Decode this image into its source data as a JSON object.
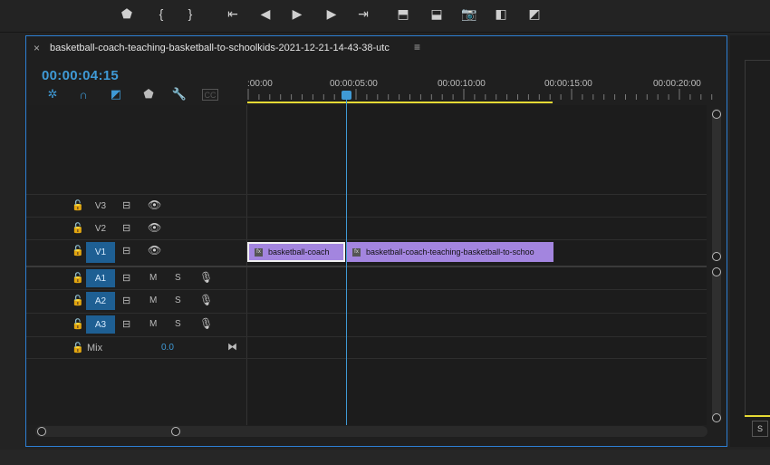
{
  "transport": {
    "buttons": [
      {
        "name": "add-marker-icon",
        "glyph": "⬟"
      },
      {
        "name": "mark-in-icon",
        "glyph": "{"
      },
      {
        "name": "mark-out-icon",
        "glyph": "}"
      },
      {
        "name": "go-to-in-icon",
        "glyph": "⇤"
      },
      {
        "name": "step-back-icon",
        "glyph": "◀"
      },
      {
        "name": "play-icon",
        "glyph": "▶"
      },
      {
        "name": "step-forward-icon",
        "glyph": "▶"
      },
      {
        "name": "go-to-out-icon",
        "glyph": "⇥"
      },
      {
        "name": "lift-icon",
        "glyph": "⬒"
      },
      {
        "name": "extract-icon",
        "glyph": "⬓"
      },
      {
        "name": "export-frame-icon",
        "glyph": "📷"
      },
      {
        "name": "compare-icon",
        "glyph": "◧"
      },
      {
        "name": "button-editor-icon",
        "glyph": "◩"
      }
    ]
  },
  "sequence": {
    "close_glyph": "×",
    "name": "basketball-coach-teaching-basketball-to-schoolkids-2021-12-21-14-43-38-utc",
    "menu_glyph": "≡",
    "timecode": "00:00:04:15"
  },
  "tools": [
    {
      "name": "snap-in-sequence-icon",
      "glyph": "✲"
    },
    {
      "name": "linked-selection-icon",
      "glyph": "∩"
    },
    {
      "name": "insert-overwrite-icon",
      "glyph": "◩"
    },
    {
      "name": "add-marker-tool-icon",
      "glyph": "⬟"
    },
    {
      "name": "settings-wrench-icon",
      "glyph": "🔧"
    },
    {
      "name": "captions-icon",
      "glyph": "CC"
    }
  ],
  "ruler": {
    "labels": [
      ":00:00",
      "00:00:05:00",
      "00:00:10:00",
      "00:00:15:00",
      "00:00:20:00"
    ]
  },
  "video_tracks": [
    {
      "name": "V3",
      "lock": "🔓",
      "sync": "⊟",
      "eye": "👁"
    },
    {
      "name": "V2",
      "lock": "🔓",
      "sync": "⊟",
      "eye": "👁"
    },
    {
      "name": "V1",
      "lock": "🔓",
      "sync": "⊟",
      "eye": "👁"
    }
  ],
  "audio_tracks": [
    {
      "name": "A1",
      "lock": "🔓",
      "sync": "⊟",
      "mute": "M",
      "solo": "S",
      "mic": "🎙"
    },
    {
      "name": "A2",
      "lock": "🔓",
      "sync": "⊟",
      "mute": "M",
      "solo": "S",
      "mic": "🎙"
    },
    {
      "name": "A3",
      "lock": "🔓",
      "sync": "⊟",
      "mute": "M",
      "solo": "S",
      "mic": "🎙"
    }
  ],
  "mix": {
    "lock": "🔓",
    "label": "Mix",
    "value": "0.0",
    "end_glyph": "⧓"
  },
  "clips": [
    {
      "label": "basketball-coach",
      "fx": "fx"
    },
    {
      "label": "basketball-coach-teaching-basketball-to-schoo",
      "fx": "fx"
    }
  ],
  "colors": {
    "accent": "#3f9ad6",
    "clip": "#a385df",
    "workarea": "#e5d934",
    "panel_border": "#2d7fd3"
  },
  "right_panel": {
    "button": "S"
  }
}
